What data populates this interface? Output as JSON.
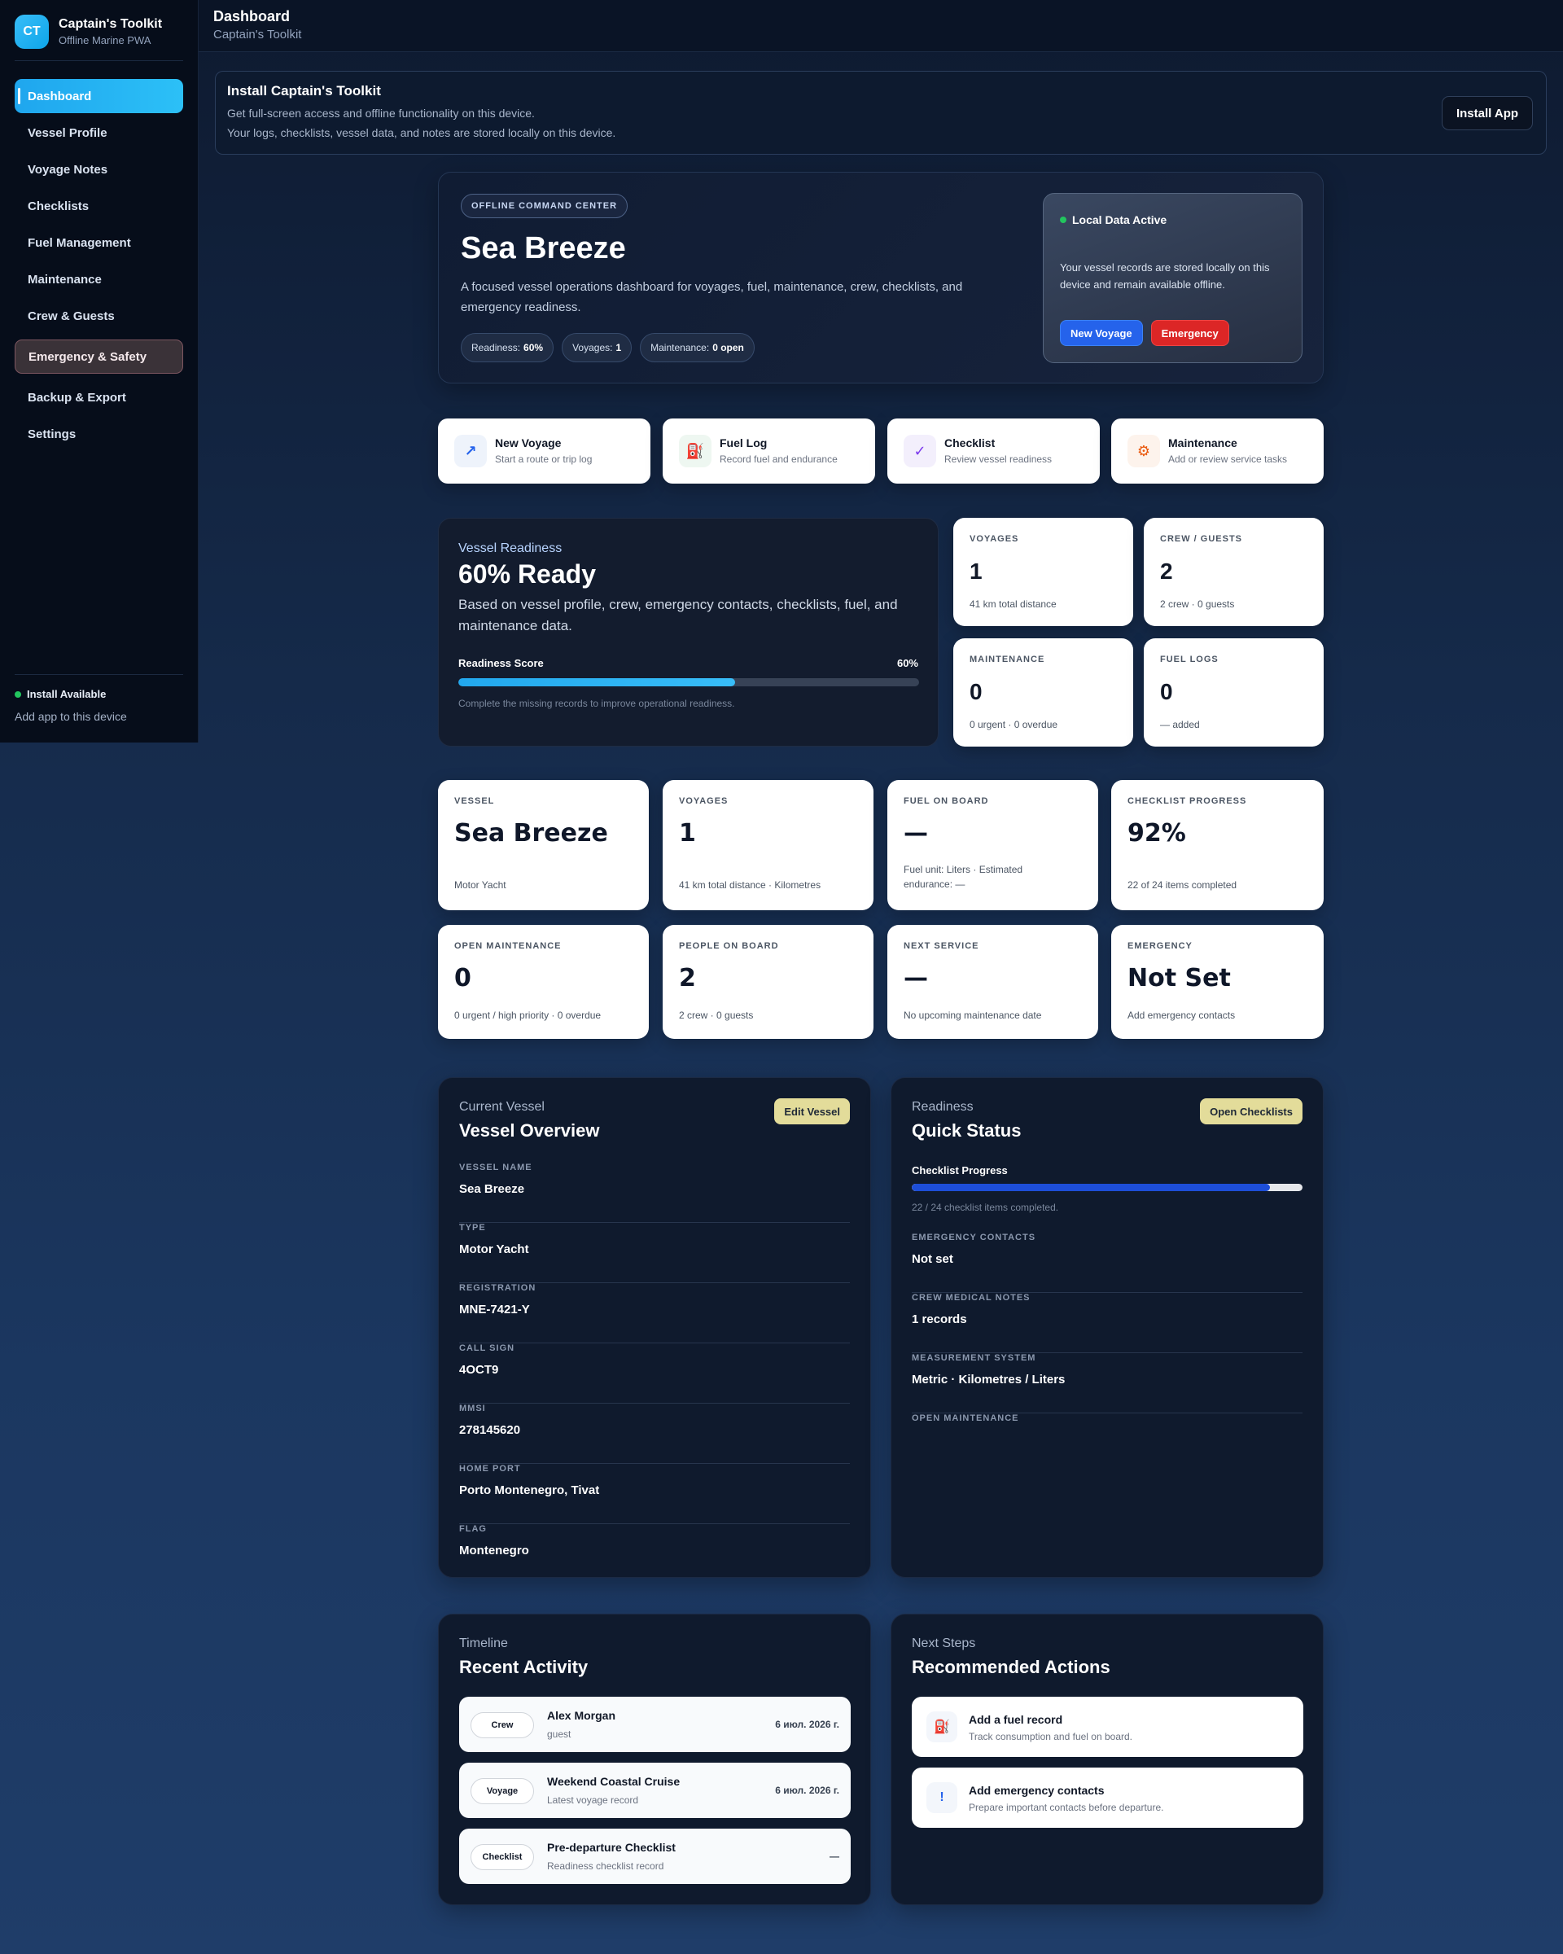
{
  "app": {
    "logo": "CT",
    "title": "Captain's Toolkit",
    "subtitle": "Offline Marine PWA"
  },
  "sidebar": {
    "items": [
      {
        "label": "Dashboard"
      },
      {
        "label": "Vessel Profile"
      },
      {
        "label": "Voyage Notes"
      },
      {
        "label": "Checklists"
      },
      {
        "label": "Fuel Management"
      },
      {
        "label": "Maintenance"
      },
      {
        "label": "Crew & Guests"
      },
      {
        "label": "Emergency & Safety"
      },
      {
        "label": "Backup & Export"
      },
      {
        "label": "Settings"
      }
    ],
    "footer": {
      "status": "Install Available",
      "sub": "Add app to this device"
    }
  },
  "header": {
    "title": "Dashboard",
    "subtitle": "Captain's Toolkit"
  },
  "install_banner": {
    "title": "Install Captain's Toolkit",
    "line1": "Get full-screen access and offline functionality on this device.",
    "line2": "Your logs, checklists, vessel data, and notes are stored locally on this device.",
    "button": "Install App"
  },
  "hero": {
    "badge": "OFFLINE COMMAND CENTER",
    "title": "Sea Breeze",
    "description": "A focused vessel operations dashboard for voyages, fuel, maintenance, crew, checklists, and emergency readiness.",
    "pills": [
      {
        "label": "Readiness:",
        "value": "60%"
      },
      {
        "label": "Voyages:",
        "value": "1"
      },
      {
        "label": "Maintenance:",
        "value": "0 open"
      }
    ],
    "local": {
      "title": "Local Data Active",
      "text": "Your vessel records are stored locally on this device and remain available offline.",
      "btn_voyage": "New Voyage",
      "btn_emergency": "Emergency"
    }
  },
  "quick_actions": [
    {
      "title": "New Voyage",
      "sub": "Start a route or trip log",
      "icon": "↗",
      "icon_name": "arrow-icon"
    },
    {
      "title": "Fuel Log",
      "sub": "Record fuel and endurance",
      "icon": "⛽",
      "icon_name": "fuel-icon"
    },
    {
      "title": "Checklist",
      "sub": "Review vessel readiness",
      "icon": "✓",
      "icon_name": "check-icon"
    },
    {
      "title": "Maintenance",
      "sub": "Add or review service tasks",
      "icon": "⚙",
      "icon_name": "gear-icon"
    }
  ],
  "readiness": {
    "over": "Vessel Readiness",
    "title": "60% Ready",
    "description": "Based on vessel profile, crew, emergency contacts, checklists, fuel, and maintenance data.",
    "score_label": "Readiness Score",
    "score_text": "60%",
    "score": 60,
    "note": "Complete the missing records to improve operational readiness."
  },
  "mini_stats": [
    {
      "label": "VOYAGES",
      "value": "1",
      "sub": "41 km total distance"
    },
    {
      "label": "CREW / GUESTS",
      "value": "2",
      "sub": "2 crew · 0 guests"
    },
    {
      "label": "MAINTENANCE",
      "value": "0",
      "sub": "0 urgent · 0 overdue"
    },
    {
      "label": "FUEL LOGS",
      "value": "0",
      "sub": "— added"
    }
  ],
  "stats": [
    {
      "label": "VESSEL",
      "value": "Sea Breeze",
      "sub": "Motor Yacht"
    },
    {
      "label": "VOYAGES",
      "value": "1",
      "sub": "41 km total distance · Kilometres"
    },
    {
      "label": "FUEL ON BOARD",
      "value": "—",
      "sub": "Fuel unit: Liters · Estimated endurance: —"
    },
    {
      "label": "CHECKLIST PROGRESS",
      "value": "92%",
      "sub": "22 of 24 items completed"
    },
    {
      "label": "OPEN MAINTENANCE",
      "value": "0",
      "sub": "0 urgent / high priority · 0 overdue"
    },
    {
      "label": "PEOPLE ON BOARD",
      "value": "2",
      "sub": "2 crew · 0 guests"
    },
    {
      "label": "NEXT SERVICE",
      "value": "—",
      "sub": "No upcoming maintenance date"
    },
    {
      "label": "EMERGENCY",
      "value": "Not Set",
      "sub": "Add emergency contacts"
    }
  ],
  "vessel_panel": {
    "over": "Current Vessel",
    "title": "Vessel Overview",
    "button": "Edit Vessel",
    "fields": [
      {
        "label": "VESSEL NAME",
        "value": "Sea Breeze"
      },
      {
        "label": "TYPE",
        "value": "Motor Yacht"
      },
      {
        "label": "REGISTRATION",
        "value": "MNE-7421-Y"
      },
      {
        "label": "CALL SIGN",
        "value": "4OCT9"
      },
      {
        "label": "MMSI",
        "value": "278145620"
      },
      {
        "label": "HOME PORT",
        "value": "Porto Montenegro, Tivat"
      },
      {
        "label": "FLAG",
        "value": "Montenegro"
      }
    ]
  },
  "status_panel": {
    "over": "Readiness",
    "title": "Quick Status",
    "button": "Open Checklists",
    "progress_label": "Checklist Progress",
    "progress": 0.917,
    "progress_note": "22 / 24 checklist items completed.",
    "fields": [
      {
        "label": "EMERGENCY CONTACTS",
        "value": "Not set"
      },
      {
        "label": "CREW MEDICAL NOTES",
        "value": "1 records"
      },
      {
        "label": "MEASUREMENT SYSTEM",
        "value": "Metric · Kilometres / Liters"
      }
    ],
    "last_label": "OPEN MAINTENANCE"
  },
  "timeline": {
    "over": "Timeline",
    "title": "Recent Activity",
    "items": [
      {
        "tag": "Crew",
        "title": "Alex Morgan",
        "sub": "guest",
        "date": "6 июл. 2026 г."
      },
      {
        "tag": "Voyage",
        "title": "Weekend Coastal Cruise",
        "sub": "Latest voyage record",
        "date": "6 июл. 2026 г."
      },
      {
        "tag": "Checklist",
        "title": "Pre-departure Checklist",
        "sub": "Readiness checklist record",
        "date": "—"
      }
    ]
  },
  "next_steps": {
    "over": "Next Steps",
    "title": "Recommended Actions",
    "items": [
      {
        "title": "Add a fuel record",
        "sub": "Track consumption and fuel on board.",
        "icon": "⛽",
        "icon_name": "fuel-icon"
      },
      {
        "title": "Add emergency contacts",
        "sub": "Prepare important contacts before departure.",
        "icon": "!",
        "icon_name": "alert-icon"
      }
    ]
  },
  "colors": {
    "accent": "#1fa6ee",
    "danger": "#dc2626",
    "primary": "#2563eb",
    "button_yellow": "#e3dc9a"
  }
}
